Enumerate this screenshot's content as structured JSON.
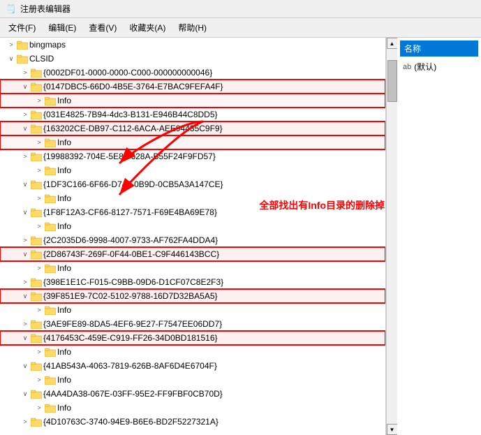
{
  "window": {
    "title": "注册表编辑器",
    "icon": "registry-editor-icon"
  },
  "menu": {
    "items": [
      "文件(F)",
      "编辑(E)",
      "查看(V)",
      "收藏夹(A)",
      "帮助(H)"
    ]
  },
  "right_panel": {
    "header": "名称",
    "items": [
      {
        "label": "ab (默认)",
        "icon": "ab-icon"
      }
    ]
  },
  "tree": {
    "nodes": [
      {
        "id": "bingmaps",
        "label": "bingmaps",
        "level": 0,
        "expanded": false,
        "is_folder": true
      },
      {
        "id": "clsid",
        "label": "CLSID",
        "level": 0,
        "expanded": true,
        "is_folder": true
      },
      {
        "id": "0002DF01",
        "label": "{0002DF01-0000-0000-C000-000000000046}",
        "level": 1,
        "expanded": false,
        "is_folder": true
      },
      {
        "id": "0147DBC5",
        "label": "{0147DBC5-66D0-4B5E-3764-E7BAC9FEFA4F}",
        "level": 1,
        "expanded": true,
        "is_folder": true,
        "highlighted": true
      },
      {
        "id": "0147DBC5_Info",
        "label": "Info",
        "level": 2,
        "expanded": false,
        "is_folder": true,
        "highlighted_info": true
      },
      {
        "id": "031E4825",
        "label": "{031E4825-7B94-4dc3-B131-E946B44C8DD5}",
        "level": 1,
        "expanded": false,
        "is_folder": true
      },
      {
        "id": "163202CE",
        "label": "{163202CE-DB97-C112-6ACA-AEE94435C9F9}",
        "level": 1,
        "expanded": true,
        "is_folder": true,
        "highlighted": true
      },
      {
        "id": "163202CE_Info",
        "label": "Info",
        "level": 2,
        "expanded": false,
        "is_folder": true,
        "highlighted_info": true
      },
      {
        "id": "19988392",
        "label": "{19988392-704E-5E84-628A-B55F24F9FD57}",
        "level": 1,
        "expanded": false,
        "is_folder": true
      },
      {
        "id": "19988392_Info",
        "label": "Info",
        "level": 2,
        "expanded": false,
        "is_folder": true
      },
      {
        "id": "1DF3C166",
        "label": "{1DF3C166-6F66-D747-0B9D-0CB5A3A147CE}",
        "level": 1,
        "expanded": true,
        "is_folder": true
      },
      {
        "id": "1DF3C166_Info",
        "label": "Info",
        "level": 2,
        "expanded": false,
        "is_folder": true
      },
      {
        "id": "1F8F12A3",
        "label": "{1F8F12A3-CF66-8127-7571-F69E4BA69E78}",
        "level": 1,
        "expanded": true,
        "is_folder": true
      },
      {
        "id": "1F8F12A3_Info",
        "label": "Info",
        "level": 2,
        "expanded": false,
        "is_folder": true
      },
      {
        "id": "2C2035D6",
        "label": "{2C2035D6-9998-4007-9733-AF762FA4DDA4}",
        "level": 1,
        "expanded": false,
        "is_folder": true
      },
      {
        "id": "2D86743F",
        "label": "{2D86743F-269F-0F44-0BE1-C9F446143BCC}",
        "level": 1,
        "expanded": true,
        "is_folder": true,
        "highlighted": true
      },
      {
        "id": "2D86743F_Info",
        "label": "Info",
        "level": 2,
        "expanded": false,
        "is_folder": true
      },
      {
        "id": "398E1E1C",
        "label": "{398E1E1C-F015-C9BB-09D6-D1CF07C8E2F3}",
        "level": 1,
        "expanded": false,
        "is_folder": true
      },
      {
        "id": "39F851E9",
        "label": "{39F851E9-7C02-5102-9788-16D7D32BA5A5}",
        "level": 1,
        "expanded": true,
        "is_folder": true,
        "highlighted": true
      },
      {
        "id": "39F851E9_Info",
        "label": "Info",
        "level": 2,
        "expanded": false,
        "is_folder": true
      },
      {
        "id": "3AE9FE89",
        "label": "{3AE9FE89-8DA5-4EF6-9E27-F7547EE06DD7}",
        "level": 1,
        "expanded": false,
        "is_folder": true
      },
      {
        "id": "4176453C",
        "label": "{4176453C-459E-C919-FF26-34D0BD181516}",
        "level": 1,
        "expanded": true,
        "is_folder": true,
        "highlighted": true
      },
      {
        "id": "4176453C_Info",
        "label": "Info",
        "level": 2,
        "expanded": false,
        "is_folder": true
      },
      {
        "id": "41AB543A",
        "label": "{41AB543A-4063-7819-626B-8AF6D4E6704F}",
        "level": 1,
        "expanded": true,
        "is_folder": true
      },
      {
        "id": "41AB543A_Info",
        "label": "Info",
        "level": 2,
        "expanded": false,
        "is_folder": true
      },
      {
        "id": "4AA4DA38",
        "label": "{4AA4DA38-067E-03FF-95E2-FF9FBF0CB70D}",
        "level": 1,
        "expanded": true,
        "is_folder": true
      },
      {
        "id": "4AA4DA38_Info",
        "label": "Info",
        "level": 2,
        "expanded": false,
        "is_folder": true
      },
      {
        "id": "4D10763C",
        "label": "{4D10763C-3740-94E9-B6E6-BD2F5227321A}",
        "level": 1,
        "expanded": false,
        "is_folder": true
      }
    ]
  },
  "annotation": {
    "text": "全部找出有Info目录的删除掉"
  },
  "colors": {
    "highlight_border": "#ff0000",
    "highlight_bg": "#fff0f0",
    "folder": "#ffd966",
    "accent": "#0078d7"
  }
}
